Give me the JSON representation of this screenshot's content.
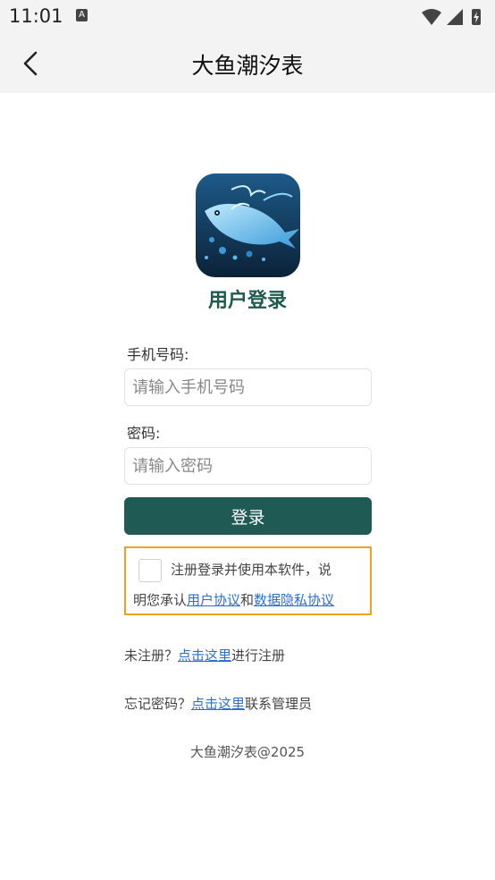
{
  "status_bar": {
    "time": "11:01",
    "notification_icon": "A"
  },
  "header": {
    "title": "大鱼潮汐表",
    "back_icon": "chevron-left-icon"
  },
  "login": {
    "heading": "用户登录",
    "phone_label": "手机号码:",
    "phone_placeholder": "请输入手机号码",
    "password_label": "密码:",
    "password_placeholder": "请输入密码",
    "submit_label": "登录"
  },
  "agreement": {
    "checked": false,
    "text_line1": "注册登录并使用本软件，说",
    "text_line2_prefix": "明您承认",
    "user_agreement_link": "用户协议",
    "conjunction": "和",
    "privacy_link": "数据隐私协议"
  },
  "register": {
    "prefix": "未注册？",
    "link": "点击这里",
    "suffix": "进行注册"
  },
  "forgot": {
    "prefix": "忘记密码？",
    "link": "点击这里",
    "suffix": "联系管理员"
  },
  "footer": {
    "copyright": "大鱼潮汐表@2025"
  },
  "colors": {
    "primary": "#1f5a55",
    "heading": "#1f5a4f",
    "link": "#2a6fd6",
    "highlight_border": "#f0a21f",
    "bar_bg": "#f3f3f3"
  }
}
